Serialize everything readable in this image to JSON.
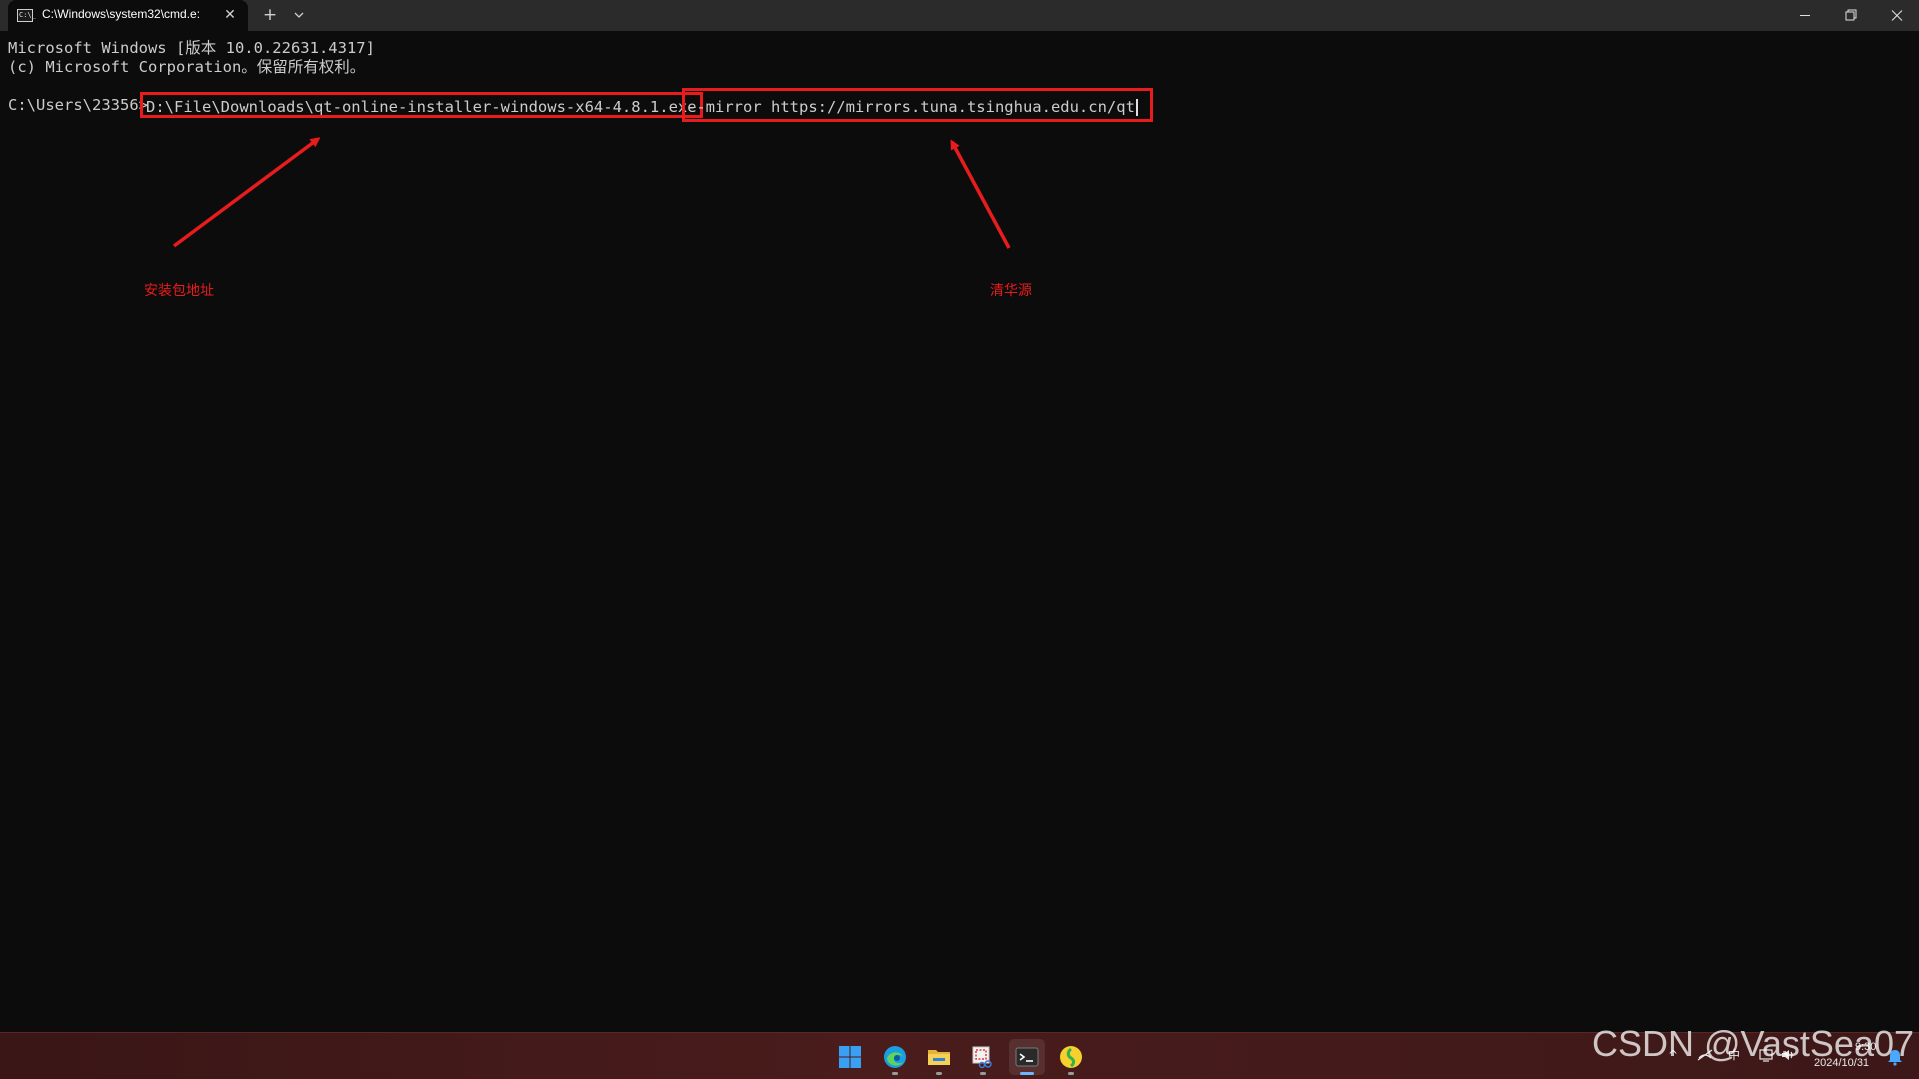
{
  "window": {
    "tab_title": "C:\\Windows\\system32\\cmd.e:",
    "tab_icon_text": "C:\\_",
    "new_tab_glyph": "+",
    "close_tab_glyph": "✕"
  },
  "terminal": {
    "header_line1": "Microsoft Windows [版本 10.0.22631.4317]",
    "header_line2": "(c) Microsoft Corporation。保留所有权利。",
    "prompt": "C:\\Users\\23356>",
    "command_path": "D:\\File\\Downloads\\qt-online-installer-windows-x64-4.8.1.exe",
    "command_args": "--mirror https://mirrors.tuna.tsinghua.edu.cn/qt"
  },
  "annotations": {
    "left_label": "安装包地址",
    "right_label": "清华源",
    "color": "#e81c1c"
  },
  "taskbar": {
    "apps": [
      "windows-start-icon",
      "edge-icon",
      "file-explorer-icon",
      "snipping-tool-icon",
      "terminal-icon",
      "qq-music-icon"
    ],
    "tray": {
      "chevron": "^",
      "ime": "中",
      "time": "9:30",
      "date": "2024/10/31"
    }
  },
  "watermark": "CSDN @VastSea07",
  "colors": {
    "terminal_bg": "#0c0c0c",
    "titlebar_bg": "#2b2b2b",
    "text": "#cccccc",
    "highlight": "#e81c1c"
  }
}
